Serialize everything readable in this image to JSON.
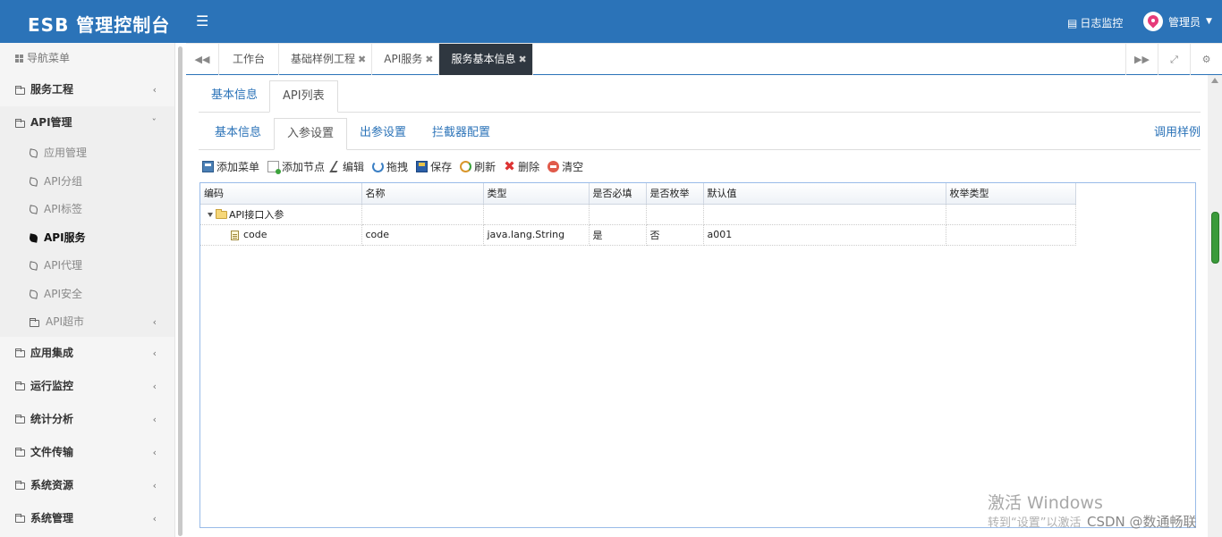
{
  "header": {
    "logo": "ESB 管理控制台",
    "log_monitor": "日志监控",
    "user": "管理员"
  },
  "sidebar": {
    "title": "导航菜单",
    "items": [
      {
        "label": "服务工程"
      },
      {
        "label": "API管理"
      },
      {
        "label": "应用集成"
      },
      {
        "label": "运行监控"
      },
      {
        "label": "统计分析"
      },
      {
        "label": "文件传输"
      },
      {
        "label": "系统资源"
      },
      {
        "label": "系统管理"
      }
    ],
    "api_sub": [
      {
        "label": "应用管理"
      },
      {
        "label": "API分组"
      },
      {
        "label": "API标签"
      },
      {
        "label": "API服务"
      },
      {
        "label": "API代理"
      },
      {
        "label": "API安全"
      },
      {
        "label": "API超市"
      }
    ]
  },
  "tabs": [
    {
      "label": "工作台"
    },
    {
      "label": "基础样例工程"
    },
    {
      "label": "API服务"
    },
    {
      "label": "服务基本信息"
    }
  ],
  "outer_tabs": [
    "基本信息",
    "API列表"
  ],
  "inner_tabs": [
    "基本信息",
    "入参设置",
    "出参设置",
    "拦截器配置"
  ],
  "call_sample": "调用样例",
  "toolbar": [
    "添加菜单",
    "添加节点",
    "编辑",
    "拖拽",
    "保存",
    "刷新",
    "删除",
    "清空"
  ],
  "grid": {
    "columns": [
      "编码",
      "名称",
      "类型",
      "是否必填",
      "是否枚举",
      "默认值",
      "枚举类型"
    ],
    "rows": [
      {
        "code": "API接口入参",
        "name": "",
        "type": "",
        "required": "",
        "enum": "",
        "default": "",
        "enum_type": ""
      },
      {
        "code": "code",
        "name": "code",
        "type": "java.lang.String",
        "required": "是",
        "enum": "否",
        "default": "a001",
        "enum_type": ""
      }
    ]
  },
  "watermark": {
    "line1": "激活 Windows",
    "line2": "转到“设置”以激活",
    "csdn": "CSDN @数通畅联"
  }
}
